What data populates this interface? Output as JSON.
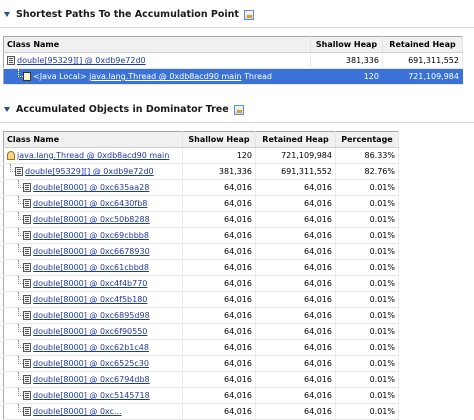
{
  "section1": {
    "title": "Shortest Paths To the Accumulation Point",
    "icon": "report-icon",
    "columns": [
      "Class Name",
      "Shallow Heap",
      "Retained Heap"
    ],
    "rows": [
      {
        "name": "double[95329][] @ 0xdb9e72d0",
        "shallow": "381,336",
        "retained": "691,311,552",
        "selected": false
      },
      {
        "prefix": "<Java Local>",
        "name": "java.lang.Thread @ 0xdb8acd90 main",
        "suffix": "Thread",
        "shallow": "120",
        "retained": "721,109,984",
        "selected": true
      }
    ]
  },
  "section2": {
    "title": "Accumulated Objects in Dominator Tree",
    "icon": "report-icon",
    "columns": [
      "Class Name",
      "Shallow Heap",
      "Retained Heap",
      "Percentage"
    ],
    "rows": [
      {
        "name": "java.lang.Thread @ 0xdb8acd90 main",
        "shallow": "120",
        "retained": "721,109,984",
        "pct": "86.33%"
      },
      {
        "name": "double[95329][] @ 0xdb9e72d0",
        "shallow": "381,336",
        "retained": "691,311,552",
        "pct": "82.76%"
      },
      {
        "name": "double[8000] @ 0xc635aa28",
        "shallow": "64,016",
        "retained": "64,016",
        "pct": "0.01%"
      },
      {
        "name": "double[8000] @ 0xc6430fb8",
        "shallow": "64,016",
        "retained": "64,016",
        "pct": "0.01%"
      },
      {
        "name": "double[8000] @ 0xc50b8288",
        "shallow": "64,016",
        "retained": "64,016",
        "pct": "0.01%"
      },
      {
        "name": "double[8000] @ 0xc69cbbb8",
        "shallow": "64,016",
        "retained": "64,016",
        "pct": "0.01%"
      },
      {
        "name": "double[8000] @ 0xc6678930",
        "shallow": "64,016",
        "retained": "64,016",
        "pct": "0.01%"
      },
      {
        "name": "double[8000] @ 0xc61cbbd8",
        "shallow": "64,016",
        "retained": "64,016",
        "pct": "0.01%"
      },
      {
        "name": "double[8000] @ 0xc4f4b770",
        "shallow": "64,016",
        "retained": "64,016",
        "pct": "0.01%"
      },
      {
        "name": "double[8000] @ 0xc4f5b180",
        "shallow": "64,016",
        "retained": "64,016",
        "pct": "0.01%"
      },
      {
        "name": "double[8000] @ 0xc6895d98",
        "shallow": "64,016",
        "retained": "64,016",
        "pct": "0.01%"
      },
      {
        "name": "double[8000] @ 0xc6f90550",
        "shallow": "64,016",
        "retained": "64,016",
        "pct": "0.01%"
      },
      {
        "name": "double[8000] @ 0xc62b1c48",
        "shallow": "64,016",
        "retained": "64,016",
        "pct": "0.01%"
      },
      {
        "name": "double[8000] @ 0xc6525c30",
        "shallow": "64,016",
        "retained": "64,016",
        "pct": "0.01%"
      },
      {
        "name": "double[8000] @ 0xc6794db8",
        "shallow": "64,016",
        "retained": "64,016",
        "pct": "0.01%"
      },
      {
        "name": "double[8000] @ 0xc5145718",
        "shallow": "64,016",
        "retained": "64,016",
        "pct": "0.01%"
      },
      {
        "name": "double[8000] @ 0xc...",
        "shallow": "64,016",
        "retained": "64,016",
        "pct": "0.01%"
      }
    ]
  }
}
